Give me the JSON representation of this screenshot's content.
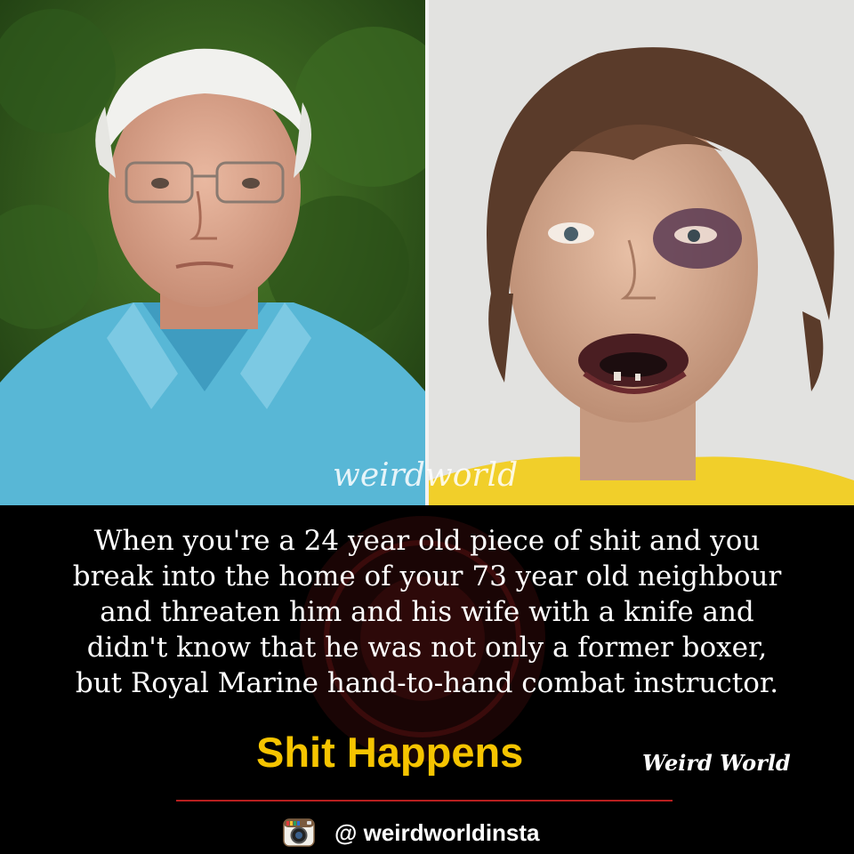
{
  "photos": {
    "left": {
      "subject": "elderly-man-portrait"
    },
    "right": {
      "subject": "injured-young-man-mugshot"
    }
  },
  "watermark": {
    "text": "weirdworld"
  },
  "caption": {
    "lines": [
      "When you're a 24 year old piece of shit and you",
      "break into the home of your 73 year old neighbour",
      "and threaten him and his wife with a knife and",
      "didn't know that he was not only a former boxer,",
      "but Royal Marine hand-to-hand combat instructor."
    ]
  },
  "tagline": "Shit Happens",
  "brand": "Weird World",
  "footer": {
    "icon": "instagram-icon",
    "handle": "@ weirdworldinsta"
  },
  "colors": {
    "background": "#000000",
    "text": "#ffffff",
    "tagline": "#f5c400",
    "rule": "#b81f1f"
  }
}
